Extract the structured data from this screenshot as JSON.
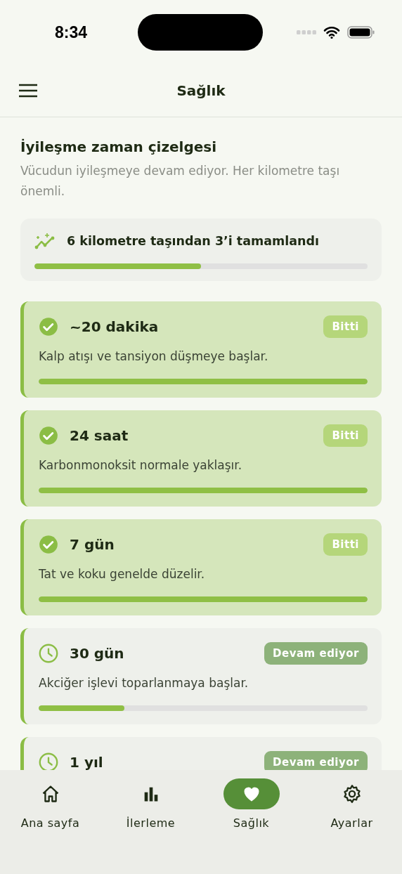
{
  "status_bar": {
    "time": "8:34"
  },
  "header": {
    "title": "Sağlık"
  },
  "intro": {
    "title": "İyileşme zaman çizelgesi",
    "subtitle": "Vücudun iyileşmeye devam ediyor. Her kilometre taşı önemli."
  },
  "summary": {
    "text": "6 kilometre taşından 3’i tamamlandı",
    "level": 0.5
  },
  "milestones": [
    {
      "kind": "done",
      "title": "~20 dakika",
      "badge": "Bitti",
      "description": "Kalp atışı ve tansiyon düşmeye başlar.",
      "level": 1
    },
    {
      "kind": "done",
      "title": "24 saat",
      "badge": "Bitti",
      "description": "Karbonmonoksit normale yaklaşır.",
      "level": 1
    },
    {
      "kind": "done",
      "title": "7 gün",
      "badge": "Bitti",
      "description": "Tat ve koku genelde düzelir.",
      "level": 1
    },
    {
      "kind": "in_progress",
      "title": "30 gün",
      "badge": "Devam ediyor",
      "description": "Akciğer işlevi toparlanmaya başlar.",
      "level": 0.26
    },
    {
      "kind": "in_progress",
      "title": "1 yıl",
      "badge": "Devam ediyor"
    }
  ],
  "nav": [
    {
      "kind": "home",
      "label": "Ana sayfa",
      "selected": false
    },
    {
      "kind": "progress",
      "label": "İlerleme",
      "selected": false
    },
    {
      "kind": "health",
      "label": "Sağlık",
      "selected": true
    },
    {
      "kind": "settings",
      "label": "Ayarlar",
      "selected": false
    }
  ]
}
